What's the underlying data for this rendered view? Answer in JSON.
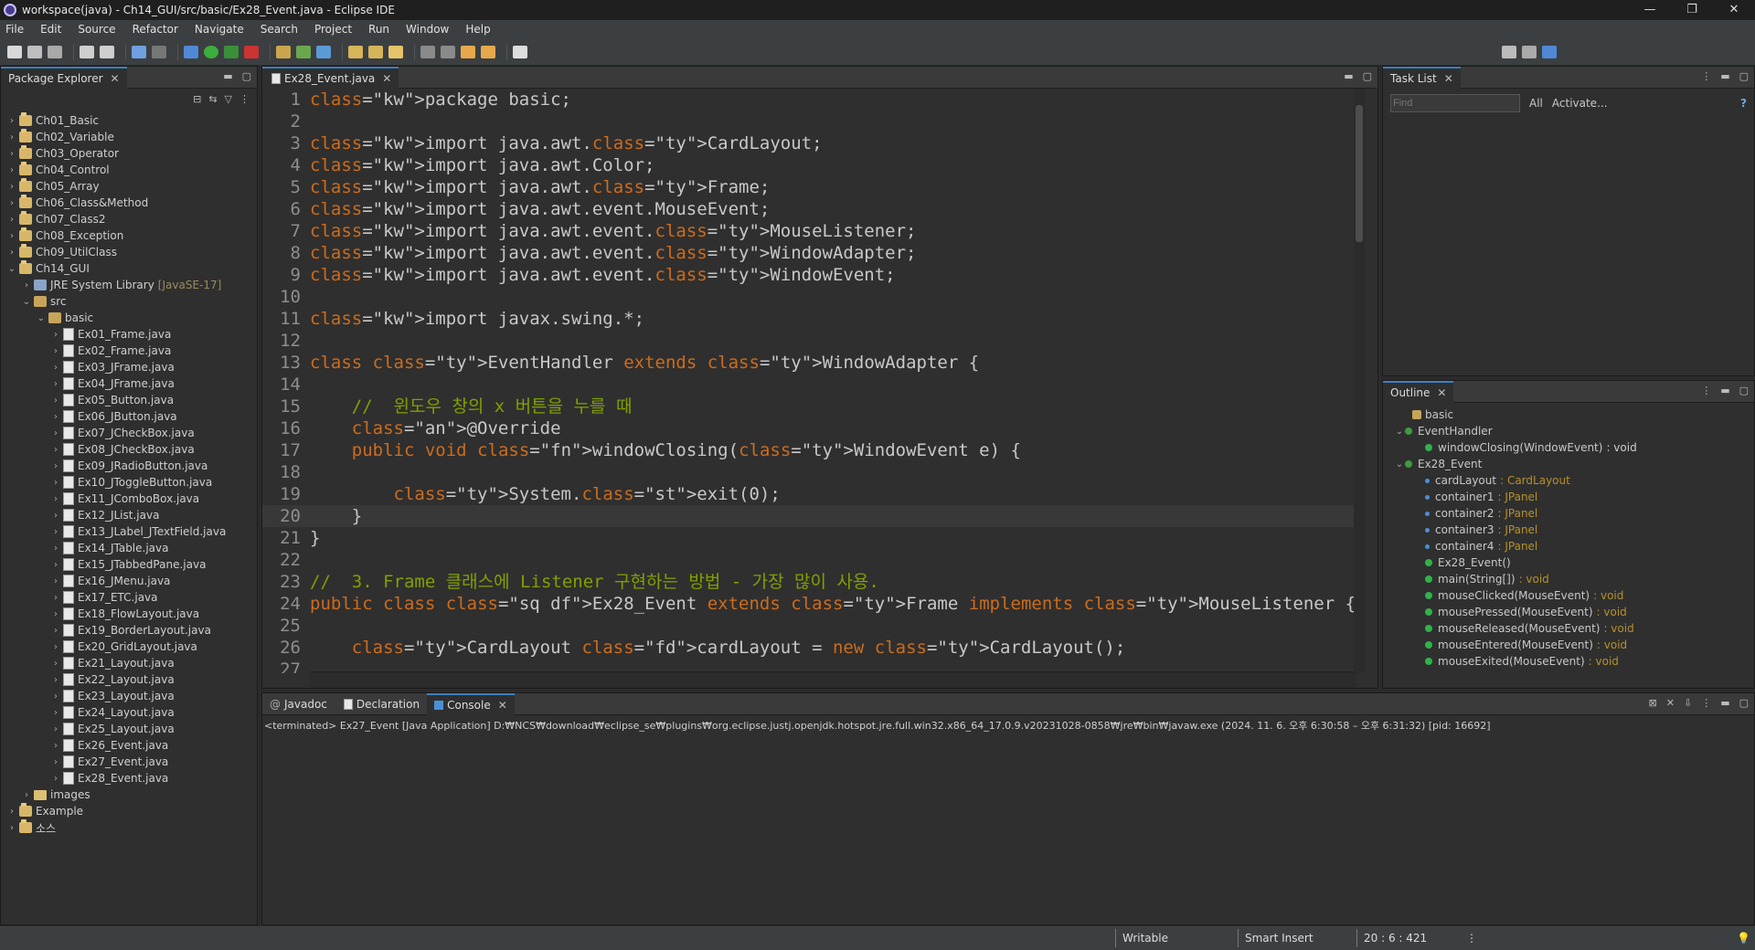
{
  "window": {
    "title": "workspace(java) - Ch14_GUI/src/basic/Ex28_Event.java - Eclipse IDE",
    "controls": [
      "—",
      "❐",
      "✕"
    ]
  },
  "menu": [
    "File",
    "Edit",
    "Source",
    "Refactor",
    "Navigate",
    "Search",
    "Project",
    "Run",
    "Window",
    "Help"
  ],
  "package_explorer": {
    "tab": "Package Explorer",
    "projects_top": [
      "Ch01_Basic",
      "Ch02_Variable",
      "Ch03_Operator",
      "Ch04_Control",
      "Ch05_Array",
      "Ch06_Class&Method",
      "Ch07_Class2",
      "Ch08_Exception",
      "Ch09_UtilClass"
    ],
    "open_project": "Ch14_GUI",
    "jre": {
      "label": "JRE System Library",
      "tag": "[JavaSE-17]"
    },
    "src": "src",
    "package": "basic",
    "files": [
      "Ex01_Frame.java",
      "Ex02_Frame.java",
      "Ex03_JFrame.java",
      "Ex04_JFrame.java",
      "Ex05_Button.java",
      "Ex06_JButton.java",
      "Ex07_JCheckBox.java",
      "Ex08_JCheckBox.java",
      "Ex09_JRadioButton.java",
      "Ex10_JToggleButton.java",
      "Ex11_JComboBox.java",
      "Ex12_JList.java",
      "Ex13_JLabel_JTextField.java",
      "Ex14_JTable.java",
      "Ex15_JTabbedPane.java",
      "Ex16_JMenu.java",
      "Ex17_ETC.java",
      "Ex18_FlowLayout.java",
      "Ex19_BorderLayout.java",
      "Ex20_GridLayout.java",
      "Ex21_Layout.java",
      "Ex22_Layout.java",
      "Ex23_Layout.java",
      "Ex24_Layout.java",
      "Ex25_Layout.java",
      "Ex26_Event.java",
      "Ex27_Event.java",
      "Ex28_Event.java"
    ],
    "images": "images",
    "projects_bottom": [
      "Example",
      "소스"
    ]
  },
  "editor": {
    "tab": "Ex28_Event.java",
    "lines": [
      {
        "n": "1",
        "t": "package basic;"
      },
      {
        "n": "2",
        "t": ""
      },
      {
        "n": "3",
        "t": "import java.awt.CardLayout;"
      },
      {
        "n": "4",
        "t": "import java.awt.Color;"
      },
      {
        "n": "5",
        "t": "import java.awt.Frame;"
      },
      {
        "n": "6",
        "t": "import java.awt.event.MouseEvent;"
      },
      {
        "n": "7",
        "t": "import java.awt.event.MouseListener;"
      },
      {
        "n": "8",
        "t": "import java.awt.event.WindowAdapter;"
      },
      {
        "n": "9",
        "t": "import java.awt.event.WindowEvent;"
      },
      {
        "n": "10",
        "t": ""
      },
      {
        "n": "11",
        "t": "import javax.swing.*;"
      },
      {
        "n": "12",
        "t": ""
      },
      {
        "n": "13",
        "t": "class EventHandler extends WindowAdapter {"
      },
      {
        "n": "14",
        "t": ""
      },
      {
        "n": "15",
        "t": "    //  윈도우 창의 x 버튼을 누를 때"
      },
      {
        "n": "16",
        "t": "    @Override"
      },
      {
        "n": "17",
        "t": "    public void windowClosing(WindowEvent e) {"
      },
      {
        "n": "18",
        "t": ""
      },
      {
        "n": "19",
        "t": "        System.exit(0);"
      },
      {
        "n": "20",
        "t": "    }"
      },
      {
        "n": "21",
        "t": "}"
      },
      {
        "n": "22",
        "t": ""
      },
      {
        "n": "23",
        "t": "//  3. Frame 클래스에 Listener 구현하는 방법 - 가장 많이 사용."
      },
      {
        "n": "24",
        "t": "public class Ex28_Event extends Frame implements MouseListener {"
      },
      {
        "n": "25",
        "t": ""
      },
      {
        "n": "26",
        "t": "    CardLayout cardLayout = new CardLayout();"
      },
      {
        "n": "27",
        "t": ""
      }
    ]
  },
  "tasklist": {
    "tab": "Task List",
    "find_placeholder": "Find",
    "all": "All",
    "activate": "Activate..."
  },
  "outline": {
    "tab": "Outline",
    "pkg": "basic",
    "class1": "EventHandler",
    "class1_method": {
      "name": "windowClosing(WindowEvent)",
      "type": ": void"
    },
    "class2": "Ex28_Event",
    "members": [
      {
        "name": "cardLayout",
        "type": ": CardLayout"
      },
      {
        "name": "container1",
        "type": ": JPanel"
      },
      {
        "name": "container2",
        "type": ": JPanel"
      },
      {
        "name": "container3",
        "type": ": JPanel"
      },
      {
        "name": "container4",
        "type": ": JPanel"
      },
      {
        "name": "Ex28_Event()",
        "type": ""
      },
      {
        "name": "main(String[])",
        "type": ": void"
      },
      {
        "name": "mouseClicked(MouseEvent)",
        "type": ": void"
      },
      {
        "name": "mousePressed(MouseEvent)",
        "type": ": void"
      },
      {
        "name": "mouseReleased(MouseEvent)",
        "type": ": void"
      },
      {
        "name": "mouseEntered(MouseEvent)",
        "type": ": void"
      },
      {
        "name": "mouseExited(MouseEvent)",
        "type": ": void"
      }
    ]
  },
  "console": {
    "tabs": [
      "Javadoc",
      "Declaration",
      "Console"
    ],
    "terminated": "<terminated> Ex27_Event [Java Application] D:₩NCS₩download₩eclipse_se₩plugins₩org.eclipse.justj.openjdk.hotspot.jre.full.win32.x86_64_17.0.9.v20231028-0858₩jre₩bin₩javaw.exe  (2024. 11. 6. 오후 6:30:58 – 오후 6:31:32) [pid: 16692]"
  },
  "status": {
    "writable": "Writable",
    "insert": "Smart Insert",
    "position": "20 : 6 : 421"
  }
}
